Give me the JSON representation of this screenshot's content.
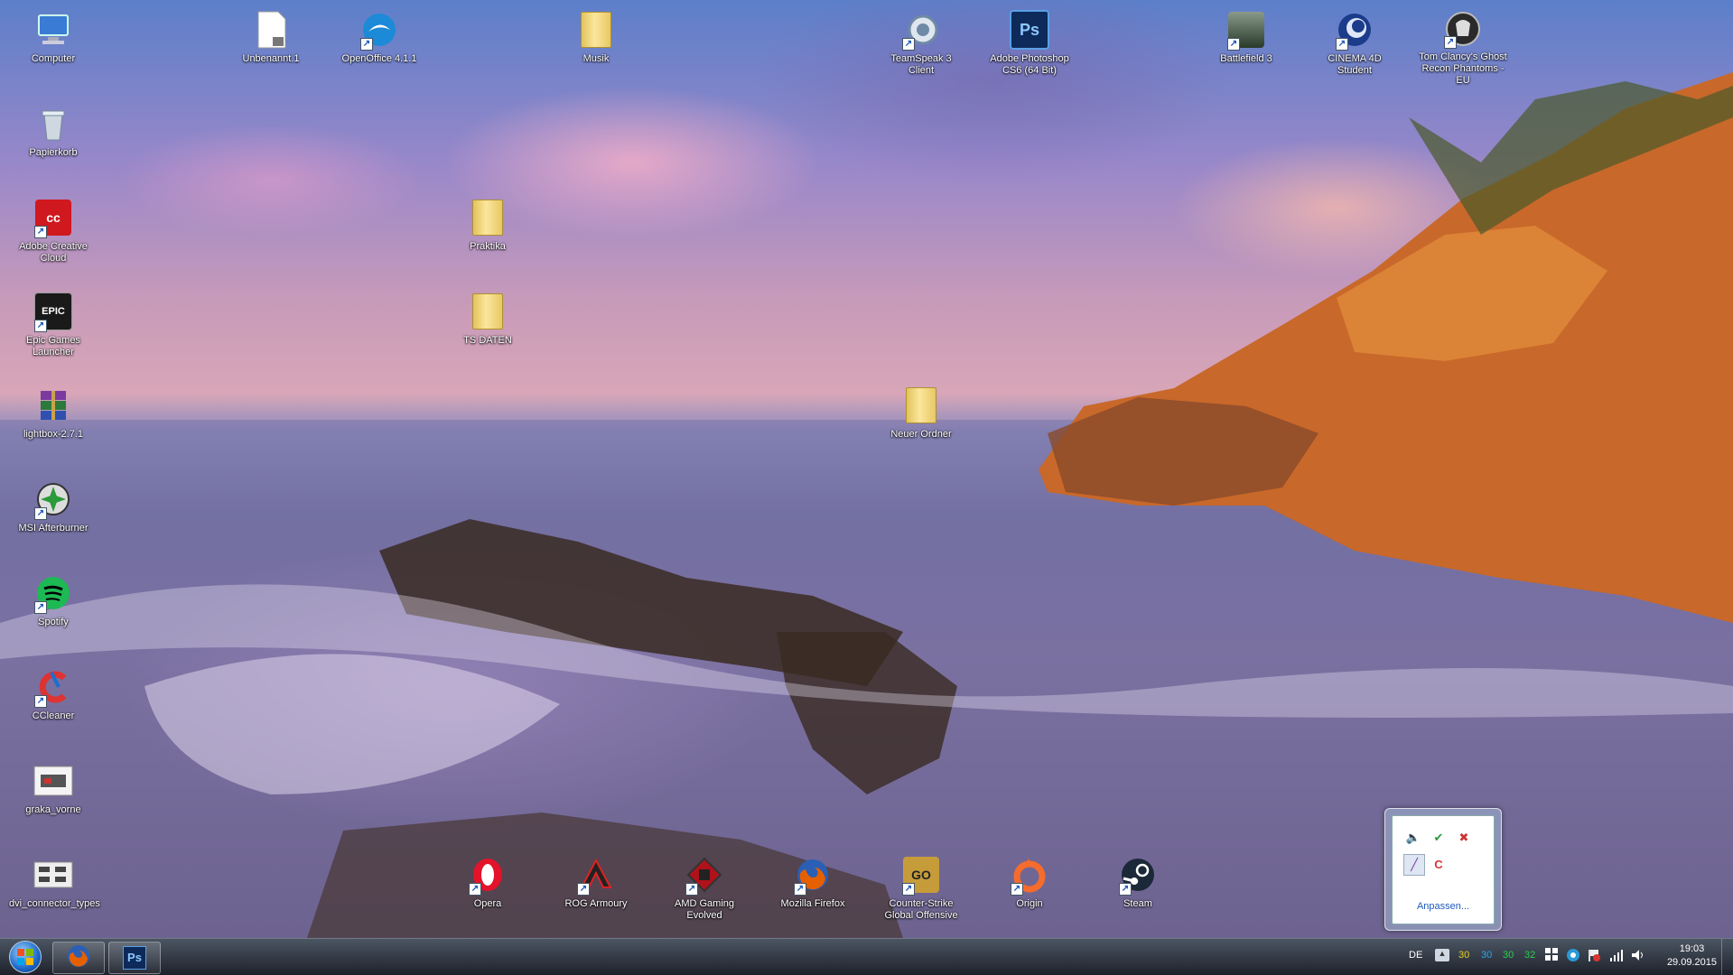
{
  "desktop": {
    "icons": [
      {
        "label": "Computer",
        "icon": "computer-icon",
        "color": "#3a7bd5"
      },
      {
        "label": "Papierkorb",
        "icon": "recycle-bin-icon",
        "color": "#9ab"
      },
      {
        "label": "Adobe Creative Cloud",
        "icon": "adobe-cc-icon",
        "color": "#d0181f"
      },
      {
        "label": "Epic Games Launcher",
        "icon": "epic-games-icon",
        "color": "#222"
      },
      {
        "label": "lightbox-2.7.1",
        "icon": "winrar-archive-icon",
        "color": "#7a3aa0"
      },
      {
        "label": "MSI Afterburner",
        "icon": "msi-afterburner-icon",
        "color": "#2a9a3a"
      },
      {
        "label": "Spotify",
        "icon": "spotify-icon",
        "color": "#1db954"
      },
      {
        "label": "CCleaner",
        "icon": "ccleaner-icon",
        "color": "#d33"
      },
      {
        "label": "graka_vorne",
        "icon": "image-file-icon",
        "color": "#eee"
      },
      {
        "label": "dvi_connector_types",
        "icon": "image-file-icon",
        "color": "#ddd"
      },
      {
        "label": "Unbenannt.1",
        "icon": "document-icon",
        "color": "#fff"
      },
      {
        "label": "OpenOffice 4.1.1",
        "icon": "openoffice-icon",
        "color": "#1c8ad6"
      },
      {
        "label": "Musik",
        "icon": "folder-icon",
        "color": "#e6c35a"
      },
      {
        "label": "Praktika",
        "icon": "folder-icon",
        "color": "#e6c35a"
      },
      {
        "label": "TS DATEN",
        "icon": "folder-icon",
        "color": "#e6c35a"
      },
      {
        "label": "Neuer Ordner",
        "icon": "folder-icon",
        "color": "#e6c35a"
      },
      {
        "label": "TeamSpeak 3 Client",
        "icon": "teamspeak-icon",
        "color": "#6f8aa6"
      },
      {
        "label": "Adobe Photoshop CS6 (64 Bit)",
        "icon": "photoshop-icon",
        "color": "#0e2a5a"
      },
      {
        "label": "Battlefield 3",
        "icon": "battlefield-icon",
        "color": "#4a5a4a"
      },
      {
        "label": "CINEMA 4D Student",
        "icon": "cinema4d-icon",
        "color": "#1b3c8a"
      },
      {
        "label": "Tom Clancy's Ghost Recon Phantoms - EU",
        "icon": "ghost-recon-icon",
        "color": "#2a2a2a"
      },
      {
        "label": "Opera",
        "icon": "opera-icon",
        "color": "#e2132a"
      },
      {
        "label": "ROG Armoury",
        "icon": "rog-armoury-icon",
        "color": "#222"
      },
      {
        "label": "AMD Gaming Evolved",
        "icon": "amd-gaming-icon",
        "color": "#b0121c"
      },
      {
        "label": "Mozilla Firefox",
        "icon": "firefox-icon",
        "color": "#e66000"
      },
      {
        "label": "Counter-Strike Global Offensive",
        "icon": "csgo-icon",
        "color": "#c69c3a"
      },
      {
        "label": "Origin",
        "icon": "origin-icon",
        "color": "#f56c2d"
      },
      {
        "label": "Steam",
        "icon": "steam-icon",
        "color": "#1b2838"
      }
    ]
  },
  "taskbar": {
    "pinned": [
      {
        "name": "firefox",
        "icon": "firefox-icon"
      },
      {
        "name": "photoshop",
        "icon": "photoshop-icon",
        "text": "Ps"
      }
    ],
    "tray": {
      "language": "DE",
      "temps": [
        "30",
        "30",
        "30",
        "32"
      ],
      "temp_colors": [
        "#e8d21a",
        "#2aa7e8",
        "#2ad04a",
        "#2ad04a"
      ],
      "time": "19:03",
      "date": "29.09.2015"
    }
  },
  "tray_popup": {
    "customize_label": "Anpassen..."
  }
}
